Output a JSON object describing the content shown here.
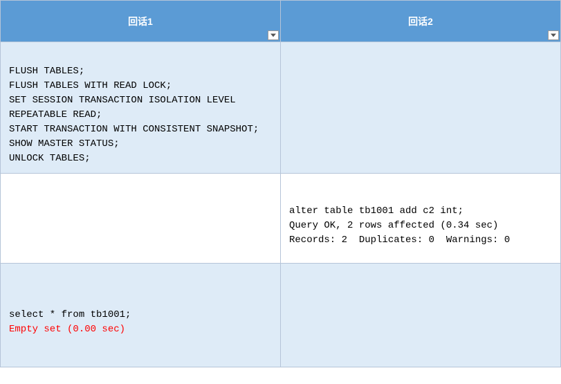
{
  "headers": {
    "col1": "回话1",
    "col2": "回话2"
  },
  "rows": [
    {
      "col1": {
        "lines": [
          "",
          "FLUSH TABLES;",
          "FLUSH TABLES WITH READ LOCK;",
          "SET SESSION TRANSACTION ISOLATION LEVEL REPEATABLE READ;",
          "START TRANSACTION WITH CONSISTENT SNAPSHOT;",
          "SHOW MASTER STATUS;",
          "UNLOCK TABLES;"
        ]
      },
      "col2": {
        "lines": []
      }
    },
    {
      "col1": {
        "lines": []
      },
      "col2": {
        "lines": [
          "",
          "alter table tb1001 add c2 int;",
          "Query OK, 2 rows affected (0.34 sec)",
          "Records: 2  Duplicates: 0  Warnings: 0"
        ]
      }
    },
    {
      "col1": {
        "lines": [
          "",
          "select * from tb1001;",
          {
            "text": "Empty set (0.00 sec)",
            "red": true
          }
        ]
      },
      "col2": {
        "lines": []
      }
    }
  ]
}
